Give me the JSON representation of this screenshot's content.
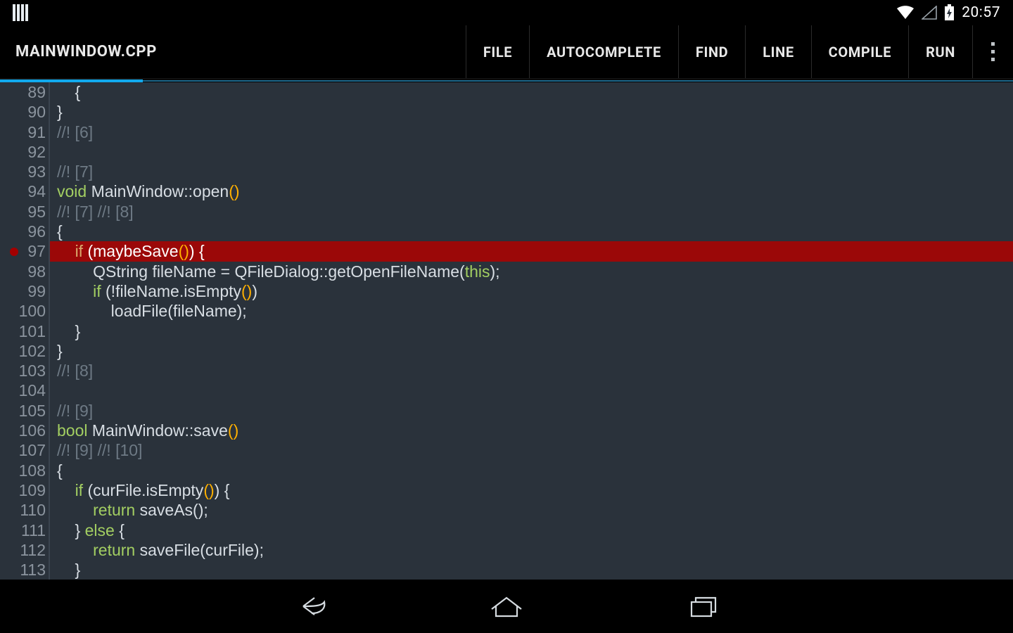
{
  "status": {
    "time": "20:57"
  },
  "action_bar": {
    "title": "MAINWINDOW.CPP",
    "items": [
      "FILE",
      "AUTOCOMPLETE",
      "FIND",
      "LINE",
      "COMPILE",
      "RUN"
    ]
  },
  "editor": {
    "breakpoint_line": 97,
    "highlight_line": 97,
    "first_line": 89,
    "lines": [
      {
        "n": 89,
        "tok": [
          [
            "p",
            "    {"
          ]
        ]
      },
      {
        "n": 90,
        "tok": [
          [
            "p",
            "}"
          ]
        ]
      },
      {
        "n": 91,
        "tok": [
          [
            "c",
            "//! [6]"
          ]
        ]
      },
      {
        "n": 92,
        "tok": [
          [
            "p",
            ""
          ]
        ]
      },
      {
        "n": 93,
        "tok": [
          [
            "c",
            "//! [7]"
          ]
        ]
      },
      {
        "n": 94,
        "tok": [
          [
            "k",
            "void"
          ],
          [
            "p",
            " MainWindow::open"
          ],
          [
            "paren",
            "()"
          ]
        ]
      },
      {
        "n": 95,
        "tok": [
          [
            "c",
            "//! [7] //! [8]"
          ]
        ]
      },
      {
        "n": 96,
        "tok": [
          [
            "p",
            "{"
          ]
        ]
      },
      {
        "n": 97,
        "tok": [
          [
            "p",
            "    "
          ],
          [
            "k",
            "if"
          ],
          [
            "p",
            " (maybeSave"
          ],
          [
            "paren",
            "()"
          ],
          [
            "p",
            ") {"
          ]
        ]
      },
      {
        "n": 98,
        "tok": [
          [
            "p",
            "        QString fileName = QFileDialog::getOpenFileName("
          ],
          [
            "k",
            "this"
          ],
          [
            "p",
            ");"
          ]
        ]
      },
      {
        "n": 99,
        "tok": [
          [
            "p",
            "        "
          ],
          [
            "k",
            "if"
          ],
          [
            "p",
            " (!fileName.isEmpty"
          ],
          [
            "paren",
            "()"
          ],
          [
            "p",
            ")"
          ]
        ]
      },
      {
        "n": 100,
        "tok": [
          [
            "p",
            "            loadFile(fileName);"
          ]
        ]
      },
      {
        "n": 101,
        "tok": [
          [
            "p",
            "    }"
          ]
        ]
      },
      {
        "n": 102,
        "tok": [
          [
            "p",
            "}"
          ]
        ]
      },
      {
        "n": 103,
        "tok": [
          [
            "c",
            "//! [8]"
          ]
        ]
      },
      {
        "n": 104,
        "tok": [
          [
            "p",
            ""
          ]
        ]
      },
      {
        "n": 105,
        "tok": [
          [
            "c",
            "//! [9]"
          ]
        ]
      },
      {
        "n": 106,
        "tok": [
          [
            "k",
            "bool"
          ],
          [
            "p",
            " MainWindow::save"
          ],
          [
            "paren",
            "()"
          ]
        ]
      },
      {
        "n": 107,
        "tok": [
          [
            "c",
            "//! [9] //! [10]"
          ]
        ]
      },
      {
        "n": 108,
        "tok": [
          [
            "p",
            "{"
          ]
        ]
      },
      {
        "n": 109,
        "tok": [
          [
            "p",
            "    "
          ],
          [
            "k",
            "if"
          ],
          [
            "p",
            " (curFile.isEmpty"
          ],
          [
            "paren",
            "()"
          ],
          [
            "p",
            ") {"
          ]
        ]
      },
      {
        "n": 110,
        "tok": [
          [
            "p",
            "        "
          ],
          [
            "k",
            "return"
          ],
          [
            "p",
            " saveAs();"
          ]
        ]
      },
      {
        "n": 111,
        "tok": [
          [
            "p",
            "    } "
          ],
          [
            "k",
            "else"
          ],
          [
            "p",
            " {"
          ]
        ]
      },
      {
        "n": 112,
        "tok": [
          [
            "p",
            "        "
          ],
          [
            "k",
            "return"
          ],
          [
            "p",
            " saveFile(curFile);"
          ]
        ]
      },
      {
        "n": 113,
        "tok": [
          [
            "p",
            "    }"
          ]
        ]
      }
    ]
  }
}
